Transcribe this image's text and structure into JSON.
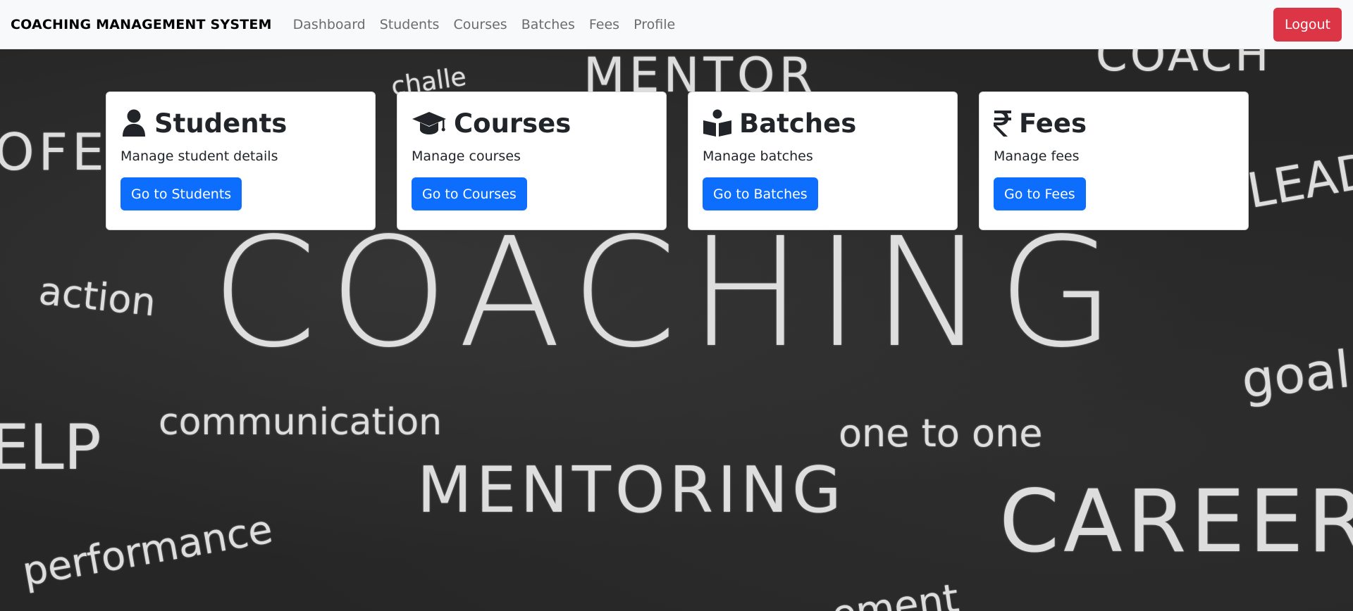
{
  "navbar": {
    "brand": "COACHING MANAGEMENT SYSTEM",
    "links": [
      "Dashboard",
      "Students",
      "Courses",
      "Batches",
      "Fees",
      "Profile"
    ],
    "logout_label": "Logout"
  },
  "cards": [
    {
      "icon": "user-icon",
      "title": "Students",
      "description": "Manage student details",
      "button_label": "Go to Students"
    },
    {
      "icon": "graduation-cap-icon",
      "title": "Courses",
      "description": "Manage courses",
      "button_label": "Go to Courses"
    },
    {
      "icon": "book-reader-icon",
      "title": "Batches",
      "description": "Manage batches",
      "button_label": "Go to Batches"
    },
    {
      "icon": "rupee-icon",
      "title": "Fees",
      "description": "Manage fees",
      "button_label": "Go to Fees"
    }
  ],
  "background_words": {
    "coaching": "COACHING",
    "mentor": "MENTOR",
    "mentoring": "MENTORING",
    "career": "CAREER",
    "communication": "communication",
    "one_to_one": "one to one",
    "action": "action",
    "performance": "performance",
    "goal": "goal",
    "lead": "LEAD",
    "help": "ELP",
    "professional": "OFE",
    "coach": "COACH",
    "challenge": "challe",
    "improvement": "ement"
  },
  "colors": {
    "logout": "#dc3545",
    "primary": "#0d6efd",
    "navbar_bg": "#f8f9fa",
    "board_bg": "#262626"
  }
}
